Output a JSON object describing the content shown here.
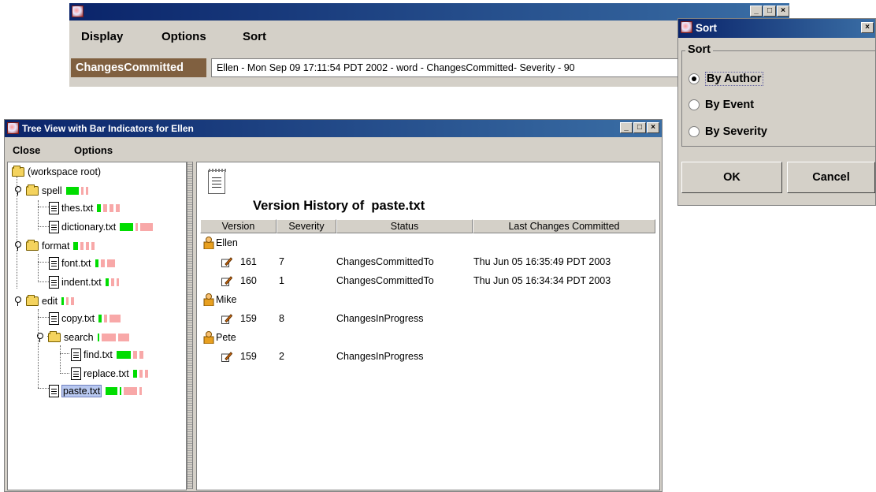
{
  "main_window": {
    "menu": [
      "Display",
      "Options",
      "Sort"
    ],
    "status_label": "ChangesCommitted",
    "status_text": "Ellen - Mon Sep 09 17:11:54 PDT 2002 - word - ChangesCommitted- Severity  - 90"
  },
  "tree_window": {
    "title": "Tree View with Bar Indicators for Ellen",
    "menu": [
      "Close",
      "Options"
    ],
    "tree": [
      {
        "label": "(workspace root)",
        "kind": "folder"
      },
      {
        "label": "spell",
        "kind": "folder"
      },
      {
        "label": "thes.txt",
        "kind": "file"
      },
      {
        "label": "dictionary.txt",
        "kind": "file"
      },
      {
        "label": "format",
        "kind": "folder"
      },
      {
        "label": "font.txt",
        "kind": "file"
      },
      {
        "label": "indent.txt",
        "kind": "file"
      },
      {
        "label": "edit",
        "kind": "folder"
      },
      {
        "label": "copy.txt",
        "kind": "file"
      },
      {
        "label": "search",
        "kind": "folder"
      },
      {
        "label": "find.txt",
        "kind": "file"
      },
      {
        "label": "replace.txt",
        "kind": "file"
      },
      {
        "label": "paste.txt",
        "kind": "file",
        "selected": true
      }
    ],
    "bar_colors": {
      "green": "#00dd00",
      "pink": "#f8a8a8"
    },
    "history": {
      "title": "Version History of  paste.txt",
      "columns": [
        "Version",
        "Severity",
        "Status",
        "Last Changes Committed"
      ],
      "groups": [
        {
          "author": "Ellen",
          "rows": [
            {
              "version": "161",
              "severity": "7",
              "status": "ChangesCommittedTo",
              "last": "Thu Jun 05 16:35:49 PDT 2003"
            },
            {
              "version": "160",
              "severity": "1",
              "status": "ChangesCommittedTo",
              "last": "Thu Jun 05 16:34:34 PDT 2003"
            }
          ]
        },
        {
          "author": "Mike",
          "rows": [
            {
              "version": "159",
              "severity": "8",
              "status": "ChangesInProgress",
              "last": ""
            }
          ]
        },
        {
          "author": "Pete",
          "rows": [
            {
              "version": "159",
              "severity": "2",
              "status": "ChangesInProgress",
              "last": ""
            }
          ]
        }
      ]
    }
  },
  "sort_dialog": {
    "title": "Sort",
    "group_label": "Sort",
    "options": [
      "By Author",
      "By Event",
      "By Severity"
    ],
    "selected": "By Author",
    "ok": "OK",
    "cancel": "Cancel"
  }
}
